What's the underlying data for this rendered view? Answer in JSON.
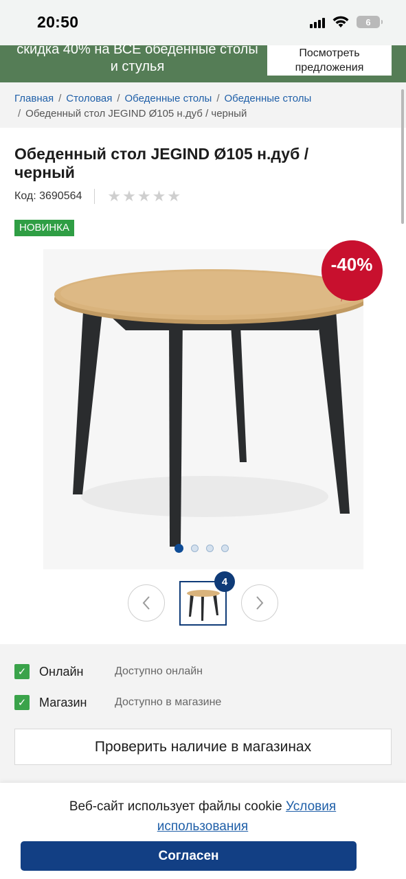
{
  "status_bar": {
    "time": "20:50",
    "battery": "6"
  },
  "promo": {
    "text": "скидка 40% на ВСЕ обеденные столы и стулья",
    "button_label": "Посмотреть предложения"
  },
  "breadcrumb": {
    "items": [
      "Главная",
      "Столовая",
      "Обеденные столы",
      "Обеденные столы"
    ],
    "current": "Обеденный стол JEGIND Ø105 н.дуб / черный",
    "separator": "/"
  },
  "product": {
    "title": "Обеденный стол JEGIND Ø105 н.дуб / черный",
    "code": "Код: 3690564",
    "rating_stars": 0,
    "badge": "НОВИНКА",
    "discount": "-40%",
    "image_count": "4",
    "gallery_active_index": 0,
    "gallery_dots": 4
  },
  "availability": {
    "rows": [
      {
        "label": "Онлайн",
        "status": "Доступно онлайн",
        "checked": true
      },
      {
        "label": "Магазин",
        "status": "Доступно в магазине",
        "checked": true
      }
    ],
    "check_button": "Проверить наличие в магазинах"
  },
  "cookie": {
    "text": "Веб-сайт использует файлы cookie",
    "link": "Условия использования",
    "accept_button": "Согласен"
  },
  "colors": {
    "promo_bg": "#557d56",
    "badge_new": "#2f9e44",
    "discount_red": "#c8102e",
    "link_blue": "#1f5fa8",
    "primary_button": "#123f84"
  },
  "icons": {
    "prev": "chevron-left-icon",
    "next": "chevron-right-icon",
    "check": "checkmark-icon",
    "star": "star-icon"
  }
}
